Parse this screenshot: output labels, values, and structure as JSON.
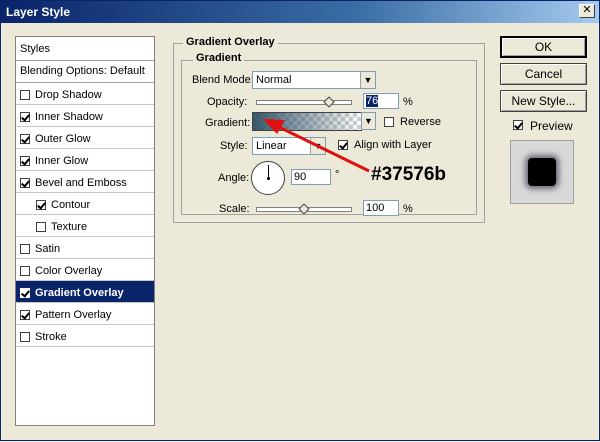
{
  "window": {
    "title": "Layer Style",
    "close_glyph": "✕"
  },
  "sidebar": {
    "header": "Styles",
    "blending": "Blending Options: Default",
    "items": [
      {
        "label": "Drop Shadow",
        "checked": false,
        "indent": false,
        "selected": false
      },
      {
        "label": "Inner Shadow",
        "checked": true,
        "indent": false,
        "selected": false
      },
      {
        "label": "Outer Glow",
        "checked": true,
        "indent": false,
        "selected": false
      },
      {
        "label": "Inner Glow",
        "checked": true,
        "indent": false,
        "selected": false
      },
      {
        "label": "Bevel and Emboss",
        "checked": true,
        "indent": false,
        "selected": false
      },
      {
        "label": "Contour",
        "checked": true,
        "indent": true,
        "selected": false
      },
      {
        "label": "Texture",
        "checked": false,
        "indent": true,
        "selected": false
      },
      {
        "label": "Satin",
        "checked": false,
        "indent": false,
        "selected": false
      },
      {
        "label": "Color Overlay",
        "checked": false,
        "indent": false,
        "selected": false
      },
      {
        "label": "Gradient Overlay",
        "checked": true,
        "indent": false,
        "selected": true
      },
      {
        "label": "Pattern Overlay",
        "checked": true,
        "indent": false,
        "selected": false
      },
      {
        "label": "Stroke",
        "checked": false,
        "indent": false,
        "selected": false
      }
    ]
  },
  "panel": {
    "outer_title": "Gradient Overlay",
    "inner_title": "Gradient",
    "blend_mode_label": "Blend Mode:",
    "blend_mode_value": "Normal",
    "opacity_label": "Opacity:",
    "opacity_value": "76",
    "opacity_unit": "%",
    "opacity_fraction": 0.76,
    "gradient_label": "Gradient:",
    "gradient_color": "#37576b",
    "reverse_label": "Reverse",
    "reverse_checked": false,
    "style_label": "Style:",
    "style_value": "Linear",
    "align_label": "Align with Layer",
    "align_checked": true,
    "angle_label": "Angle:",
    "angle_value": "90",
    "angle_unit": "°",
    "scale_label": "Scale:",
    "scale_value": "100",
    "scale_unit": "%",
    "scale_fraction": 0.5
  },
  "buttons": {
    "ok": "OK",
    "cancel": "Cancel",
    "new_style": "New Style...",
    "preview_label": "Preview",
    "preview_checked": true
  },
  "annotation": {
    "text": "#37576b",
    "arrow_color": "#e01010"
  }
}
